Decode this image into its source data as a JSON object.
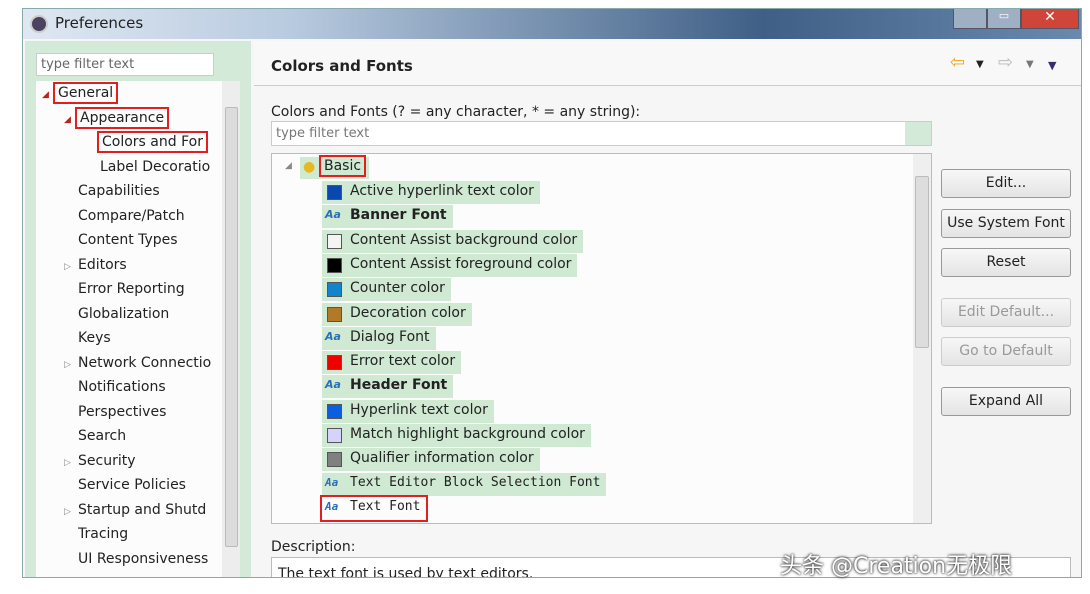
{
  "window": {
    "title": "Preferences"
  },
  "left": {
    "filter_placeholder": "type filter text",
    "tree": [
      {
        "label": "General",
        "indent": 0,
        "expander": "expanded",
        "highlight": true
      },
      {
        "label": "Appearance",
        "indent": 1,
        "expander": "expanded",
        "highlight": true
      },
      {
        "label": "Colors and For",
        "indent": 2,
        "expander": "",
        "highlight": true,
        "selected": true
      },
      {
        "label": "Label Decoratio",
        "indent": 2,
        "expander": ""
      },
      {
        "label": "Capabilities",
        "indent": 1,
        "expander": ""
      },
      {
        "label": "Compare/Patch",
        "indent": 1,
        "expander": ""
      },
      {
        "label": "Content Types",
        "indent": 1,
        "expander": ""
      },
      {
        "label": "Editors",
        "indent": 1,
        "expander": "collapsed"
      },
      {
        "label": "Error Reporting",
        "indent": 1,
        "expander": ""
      },
      {
        "label": "Globalization",
        "indent": 1,
        "expander": ""
      },
      {
        "label": "Keys",
        "indent": 1,
        "expander": ""
      },
      {
        "label": "Network Connectio",
        "indent": 1,
        "expander": "collapsed"
      },
      {
        "label": "Notifications",
        "indent": 1,
        "expander": ""
      },
      {
        "label": "Perspectives",
        "indent": 1,
        "expander": ""
      },
      {
        "label": "Search",
        "indent": 1,
        "expander": ""
      },
      {
        "label": "Security",
        "indent": 1,
        "expander": "collapsed"
      },
      {
        "label": "Service Policies",
        "indent": 1,
        "expander": ""
      },
      {
        "label": "Startup and Shutd",
        "indent": 1,
        "expander": "collapsed"
      },
      {
        "label": "Tracing",
        "indent": 1,
        "expander": ""
      },
      {
        "label": "UI Responsiveness",
        "indent": 1,
        "expander": ""
      }
    ]
  },
  "page": {
    "title": "Colors and Fonts",
    "filter_label": "Colors and Fonts (? = any character, * = any string):",
    "filter_placeholder": "type filter text",
    "category": "Basic",
    "items": [
      {
        "label": "Active hyperlink text color",
        "type": "color",
        "color": "#0a48b0"
      },
      {
        "label": "Banner Font",
        "type": "font",
        "bold": true
      },
      {
        "label": "Content Assist background color",
        "type": "color",
        "color": "#f4f4f4"
      },
      {
        "label": "Content Assist foreground color",
        "type": "color",
        "color": "#000000"
      },
      {
        "label": "Counter color",
        "type": "color",
        "color": "#1284cc"
      },
      {
        "label": "Decoration color",
        "type": "color",
        "color": "#b07a28"
      },
      {
        "label": "Dialog Font",
        "type": "font"
      },
      {
        "label": "Error text color",
        "type": "color",
        "color": "#ee0000"
      },
      {
        "label": "Header Font",
        "type": "font",
        "bold": true
      },
      {
        "label": "Hyperlink text color",
        "type": "color",
        "color": "#0a5fe0"
      },
      {
        "label": "Match highlight background color",
        "type": "color",
        "color": "#d4d4fa"
      },
      {
        "label": "Qualifier information color",
        "type": "color",
        "color": "#808080"
      },
      {
        "label": "Text Editor Block Selection Font",
        "type": "font",
        "mono": true
      },
      {
        "label": "Text Font",
        "type": "font",
        "mono": true,
        "highlight": true
      }
    ],
    "buttons": [
      {
        "label": "Edit...",
        "enabled": true
      },
      {
        "label": "Use System Font",
        "enabled": true
      },
      {
        "label": "Reset",
        "enabled": true
      },
      {
        "label": "Edit Default...",
        "enabled": false
      },
      {
        "label": "Go to Default",
        "enabled": false
      },
      {
        "label": "Expand All",
        "enabled": true
      }
    ],
    "description_label": "Description:",
    "description": "The text font is used by text editors."
  },
  "watermark": "头条 @Creation无极限",
  "colors": {
    "highlight_red": "#e02020",
    "green_bg": "#cfe9d3"
  }
}
